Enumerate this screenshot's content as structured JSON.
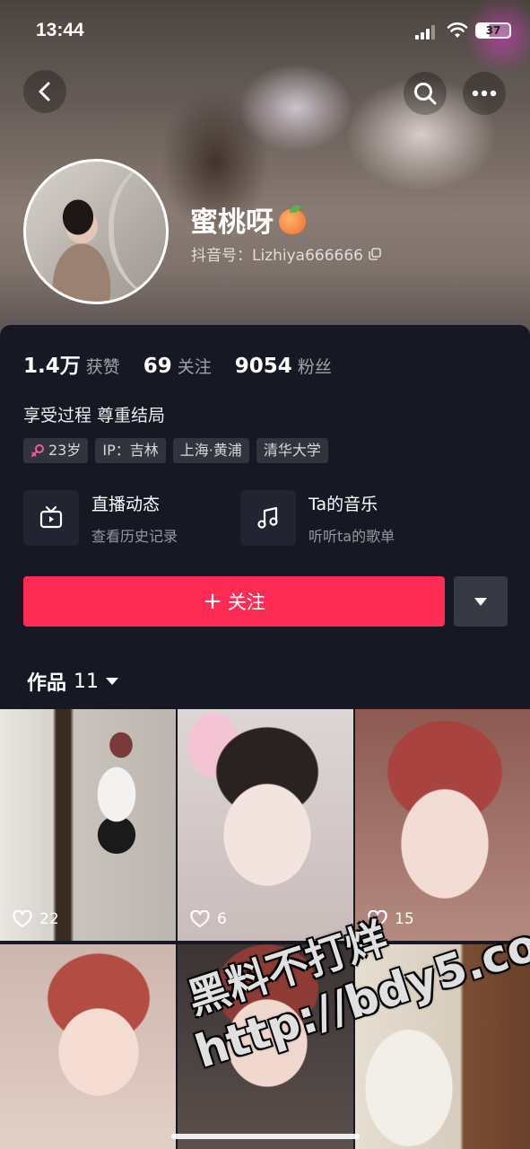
{
  "status_bar": {
    "time": "13:44",
    "battery": "37"
  },
  "profile": {
    "nickname": "蜜桃呀",
    "douyin_id": "抖音号：Lizhiya666666",
    "avatar": "avatar",
    "stats": [
      {
        "value": "1.4万",
        "label": "获赞"
      },
      {
        "value": "69",
        "label": "关注"
      },
      {
        "value": "9054",
        "label": "粉丝"
      }
    ],
    "bio": "享受过程 尊重结局",
    "tags": [
      {
        "icon": "female-icon",
        "label": "23岁"
      },
      {
        "label": "IP：吉林"
      },
      {
        "label": "上海·黄浦"
      },
      {
        "label": "清华大学"
      }
    ]
  },
  "features": {
    "live": {
      "title": "直播动态",
      "subtitle": "查看历史记录",
      "icon": "tv-icon"
    },
    "music": {
      "title": "Ta的音乐",
      "subtitle": "听听ta的歌单",
      "icon": "music-note-icon"
    }
  },
  "actions": {
    "follow_label": "关注",
    "follow_icon": "plus-icon",
    "dropdown_icon": "caret-down-icon"
  },
  "works": {
    "tab_label": "作品",
    "count": "11",
    "items": [
      {
        "likes": "22"
      },
      {
        "likes": "6"
      },
      {
        "likes": "15"
      },
      {
        "likes": ""
      },
      {
        "likes": ""
      },
      {
        "likes": ""
      }
    ]
  },
  "watermark": {
    "line1": "黑料不打烊",
    "line2": "http://bdy5.co"
  },
  "colors": {
    "accent": "#fe2c55",
    "background": "#161823",
    "secondary_button": "#363842"
  }
}
